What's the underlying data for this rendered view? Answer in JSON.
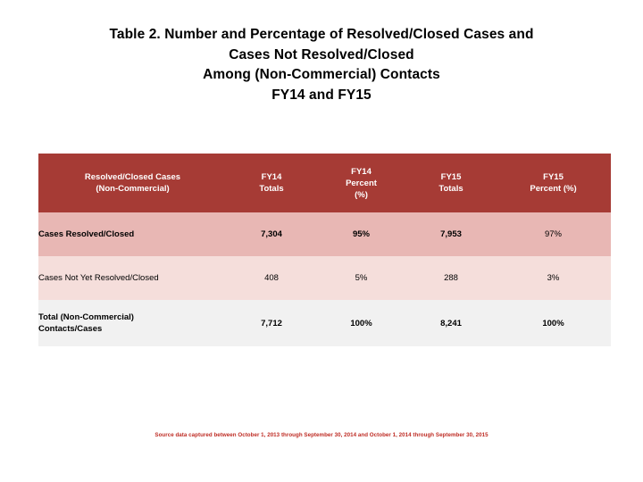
{
  "title": {
    "lines": [
      "Table 2. Number and Percentage of  Resolved/Closed Cases and",
      "Cases Not Resolved/Closed",
      "Among (Non-Commercial) Contacts",
      "FY14 and FY15"
    ]
  },
  "table": {
    "headers": [
      "Resolved/Closed  Cases\n(Non-Commercial)",
      "FY14\nTotals",
      "FY14\nPercent\n(%)",
      "FY15\nTotals",
      "FY15\nPercent (%)"
    ],
    "header_label_line1": "Resolved/Closed  Cases",
    "header_label_line2": "(Non-Commercial)",
    "header_fy14_totals_line1": "FY14",
    "header_fy14_totals_line2": "Totals",
    "header_fy14_percent_line1": "FY14",
    "header_fy14_percent_line2": "Percent",
    "header_fy14_percent_line3": "(%)",
    "header_fy15_totals_line1": "FY15",
    "header_fy15_totals_line2": "Totals",
    "header_fy15_percent_line1": "FY15",
    "header_fy15_percent_line2": "Percent (%)",
    "rows": [
      {
        "label": "Cases Resolved/Closed",
        "fy14_total": "7,304",
        "fy14_percent": "95%",
        "fy15_total": "7,953",
        "fy15_percent": "97%"
      },
      {
        "label": "Cases Not Yet Resolved/Closed",
        "fy14_total": "408",
        "fy14_percent": "5%",
        "fy15_total": "288",
        "fy15_percent": "3%"
      }
    ],
    "total_row": {
      "label_line1": "Total  (Non-Commercial)",
      "label_line2": "Contacts/Cases",
      "fy14_total": "7,712",
      "fy14_percent": "100%",
      "fy15_total": "8,241",
      "fy15_percent": "100%"
    }
  },
  "source_note": "Source data captured between October 1, 2013 through September 30, 2014 and October 1, 2014 through September 30, 2015",
  "colors": {
    "header_band": "#A63B35",
    "row_a": "#E8B7B4",
    "row_b": "#F5DEDB",
    "row_total": "#F1F1F1",
    "source_text": "#BE2B23"
  }
}
